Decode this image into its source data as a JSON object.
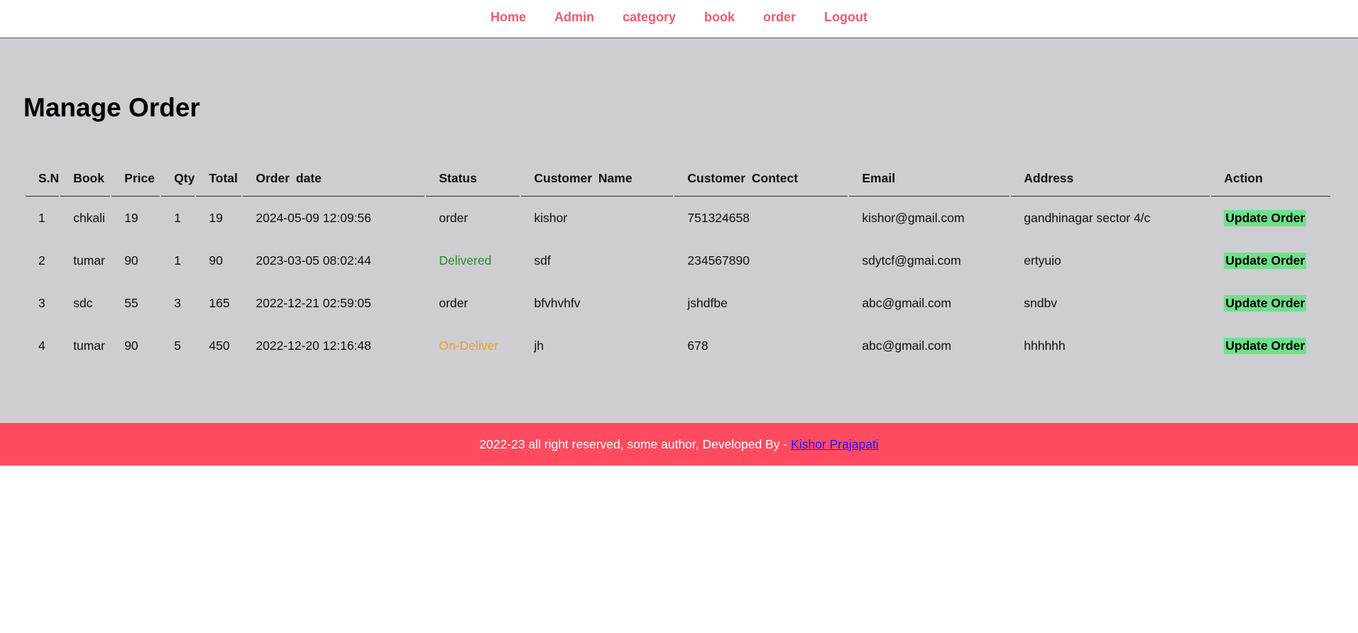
{
  "nav": {
    "items": [
      "Home",
      "Admin",
      "category",
      "book",
      "order",
      "Logout"
    ]
  },
  "page": {
    "title": "Manage Order"
  },
  "table": {
    "headers": [
      "S.N",
      "Book",
      "Price",
      "Qty",
      "Total",
      "Order date",
      "Status",
      "Customer Name",
      "Customer Contect",
      "Email",
      "Address",
      "Action"
    ],
    "rows": [
      {
        "sn": "1",
        "book": "chkali",
        "price": "19",
        "qty": "1",
        "total": "19",
        "date": "2024-05-09 12:09:56",
        "status": "order",
        "status_color": "#111111",
        "name": "kishor",
        "contact": "751324658",
        "email": "kishor@gmail.com",
        "address": "gandhinagar sector 4/c",
        "action": "Update Order"
      },
      {
        "sn": "2",
        "book": "tumar",
        "price": "90",
        "qty": "1",
        "total": "90",
        "date": "2023-03-05 08:02:44",
        "status": "Delivered",
        "status_color": "#2a8a2a",
        "name": "sdf",
        "contact": "234567890",
        "email": "sdytcf@gmai.com",
        "address": "ertyuio",
        "action": "Update Order"
      },
      {
        "sn": "3",
        "book": "sdc",
        "price": "55",
        "qty": "3",
        "total": "165",
        "date": "2022-12-21 02:59:05",
        "status": "order",
        "status_color": "#111111",
        "name": "bfvhvhfv",
        "contact": "jshdfbe",
        "email": "abc@gmail.com",
        "address": "sndbv",
        "action": "Update Order"
      },
      {
        "sn": "4",
        "book": "tumar",
        "price": "90",
        "qty": "5",
        "total": "450",
        "date": "2022-12-20 12:16:48",
        "status": "On-Deliver",
        "status_color": "#f0a020",
        "name": "jh",
        "contact": "678",
        "email": "abc@gmail.com",
        "address": "hhhhhh",
        "action": "Update Order"
      }
    ]
  },
  "footer": {
    "text": "2022-23 all right reserved, some author, Developed By -",
    "link_text": "Kishor Prajapati"
  },
  "colors": {
    "nav_link": "#f25a6e",
    "main_bg": "#cdcdd2",
    "footer_bg": "#ff4b5f",
    "action_bg": "#6fe08a"
  }
}
